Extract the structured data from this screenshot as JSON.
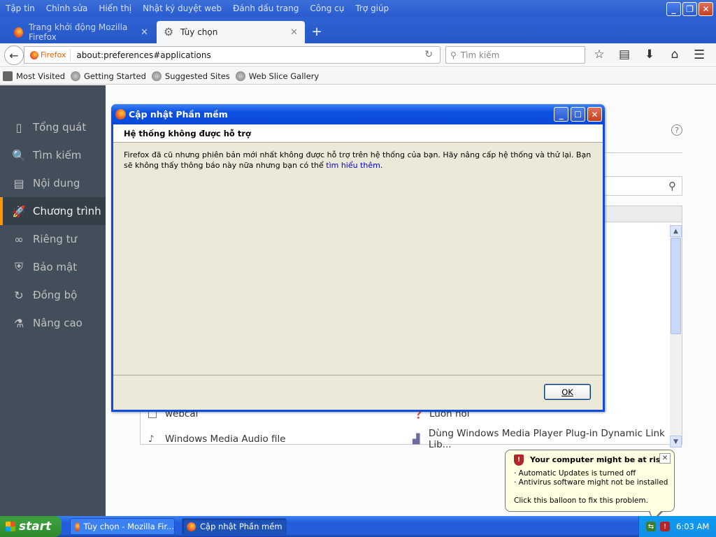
{
  "menubar": {
    "items": [
      "Tập tin",
      "Chỉnh sửa",
      "Hiển thị",
      "Nhật ký duyệt web",
      "Đánh dấu trang",
      "Công cụ",
      "Trợ giúp"
    ]
  },
  "tabs": [
    {
      "label": "Trang khởi động Mozilla Firefox",
      "close": "✕"
    },
    {
      "label": "Tùy chọn",
      "close": "✕"
    }
  ],
  "new_tab": "+",
  "navbar": {
    "identity": "Firefox",
    "url": "about:preferences#applications",
    "search_placeholder": "Tìm kiếm"
  },
  "bookmarks": [
    "Most Visited",
    "Getting Started",
    "Suggested Sites",
    "Web Slice Gallery"
  ],
  "sidebar": {
    "items": [
      {
        "label": "Tổng quát",
        "icon": "general-icon",
        "glyph": "▯"
      },
      {
        "label": "Tìm kiếm",
        "icon": "search-icon",
        "glyph": "🔍"
      },
      {
        "label": "Nội dung",
        "icon": "content-icon",
        "glyph": "▤"
      },
      {
        "label": "Chương trình",
        "icon": "applications-icon",
        "glyph": "🚀"
      },
      {
        "label": "Riêng tư",
        "icon": "privacy-mask-icon",
        "glyph": "∞"
      },
      {
        "label": "Bảo mật",
        "icon": "security-icon",
        "glyph": "⛨"
      },
      {
        "label": "Đồng bộ",
        "icon": "sync-icon",
        "glyph": "↻"
      },
      {
        "label": "Nâng cao",
        "icon": "advanced-wizard-icon",
        "glyph": "⚗"
      }
    ],
    "selected": "Chương trình"
  },
  "content_rows": [
    {
      "type": "webcal",
      "action": "Luôn hỏi"
    },
    {
      "type": "Windows Media Audio file",
      "action": "Dùng Windows Media Player Plug-in Dynamic Link Lib..."
    }
  ],
  "dialog": {
    "title": "Cập nhật Phần mềm",
    "heading": "Hệ thống không được hỗ trợ",
    "message": "Firefox đã cũ nhưng phiên bản mới nhất không được hỗ trợ trên hệ thống của bạn. Hãy nâng cấp hệ thống và thử lại. Bạn sẽ không thấy thông báo này nữa nhưng bạn có thể ",
    "link": "tìm hiểu thêm",
    "message_end": ".",
    "ok": "OK"
  },
  "balloon": {
    "title": "Your computer might be at risk",
    "lines": [
      "· Automatic Updates is turned off",
      "· Antivirus software might not be installed"
    ],
    "footer": "Click this balloon to fix this problem.",
    "close": "✕"
  },
  "taskbar": {
    "start": "start",
    "tasks": [
      "Tùy chọn - Mozilla Fir...",
      "Cập nhật Phần mềm"
    ],
    "clock": "6:03 AM"
  },
  "colors": {
    "xp_blue": "#245edb",
    "sidebar_bg": "#424f5a",
    "selected_accent": "#ff9500",
    "dialog_bg": "#ece9d8",
    "balloon_bg": "#ffffe1"
  }
}
